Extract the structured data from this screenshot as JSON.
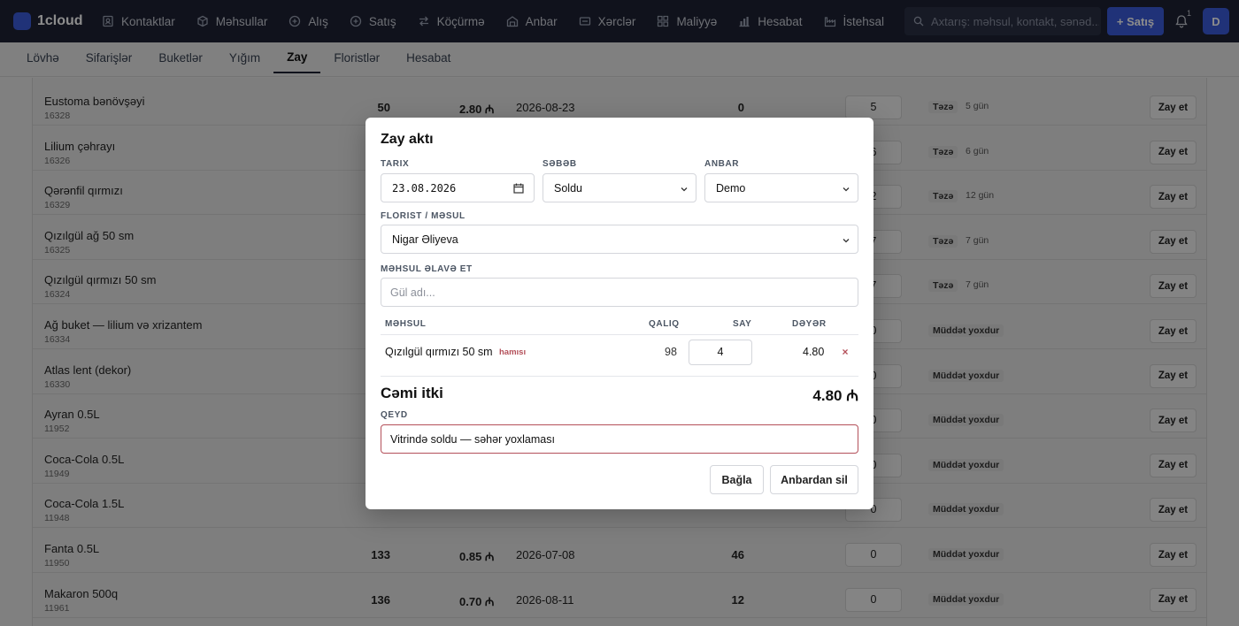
{
  "brand": {
    "name": "1cloud"
  },
  "nav": [
    {
      "label": "Kontaktlar",
      "icon": "contacts-icon"
    },
    {
      "label": "Məhsullar",
      "icon": "box-icon"
    },
    {
      "label": "Alış",
      "icon": "plus-circle-icon"
    },
    {
      "label": "Satış",
      "icon": "plus-circle-icon"
    },
    {
      "label": "Köçürmə",
      "icon": "transfer-icon"
    },
    {
      "label": "Anbar",
      "icon": "warehouse-icon"
    },
    {
      "label": "Xərclər",
      "icon": "wallet-icon"
    },
    {
      "label": "Maliyyə",
      "icon": "grid-icon"
    },
    {
      "label": "Hesabat",
      "icon": "bar-chart-icon"
    },
    {
      "label": "İstehsal",
      "icon": "factory-icon"
    }
  ],
  "search": {
    "placeholder": "Axtarış: məhsul, kontakt, sənəd..."
  },
  "header": {
    "sale_button": "+ Satış",
    "notif_count": "1",
    "avatar": "D"
  },
  "subtabs": [
    {
      "label": "Lövhə",
      "active": false
    },
    {
      "label": "Sifarişlər",
      "active": false
    },
    {
      "label": "Buketlər",
      "active": false
    },
    {
      "label": "Yığım",
      "active": false
    },
    {
      "label": "Zay",
      "active": true
    },
    {
      "label": "Floristlər",
      "active": false
    },
    {
      "label": "Hesabat",
      "active": false
    }
  ],
  "currency": "₼",
  "rows": [
    {
      "name": "Eustoma bənövşəyi",
      "id": "16328",
      "stock": "50",
      "price": "2.80 ₼",
      "date": "2026-08-23",
      "sold": "0",
      "qty": "5",
      "badge": "Təzə",
      "days": "5 gün",
      "action": "Zay et"
    },
    {
      "name": "Lilium çəhrayı",
      "id": "16326",
      "stock": "",
      "price": "",
      "date": "",
      "sold": "",
      "qty": "6",
      "badge": "Təzə",
      "days": "6 gün",
      "action": "Zay et"
    },
    {
      "name": "Qərənfil qırmızı",
      "id": "16329",
      "stock": "",
      "price": "",
      "date": "",
      "sold": "",
      "qty": "2",
      "badge": "Təzə",
      "days": "12 gün",
      "action": "Zay et"
    },
    {
      "name": "Qızılgül ağ 50 sm",
      "id": "16325",
      "stock": "",
      "price": "",
      "date": "",
      "sold": "",
      "qty": "7",
      "badge": "Təzə",
      "days": "7 gün",
      "action": "Zay et"
    },
    {
      "name": "Qızılgül qırmızı 50 sm",
      "id": "16324",
      "stock": "",
      "price": "",
      "date": "",
      "sold": "",
      "qty": "7",
      "badge": "Təzə",
      "days": "7 gün",
      "action": "Zay et"
    },
    {
      "name": "Ağ buket — lilium və xrizantem",
      "id": "16334",
      "stock": "",
      "price": "",
      "date": "",
      "sold": "",
      "qty": "0",
      "badge": "Müddət yoxdur",
      "days": "",
      "action": "Zay et"
    },
    {
      "name": "Atlas lent (dekor)",
      "id": "16330",
      "stock": "",
      "price": "",
      "date": "",
      "sold": "",
      "qty": "0",
      "badge": "Müddət yoxdur",
      "days": "",
      "action": "Zay et"
    },
    {
      "name": "Ayran 0.5L",
      "id": "11952",
      "stock": "",
      "price": "",
      "date": "",
      "sold": "",
      "qty": "0",
      "badge": "Müddət yoxdur",
      "days": "",
      "action": "Zay et"
    },
    {
      "name": "Coca-Cola 0.5L",
      "id": "11949",
      "stock": "",
      "price": "",
      "date": "",
      "sold": "",
      "qty": "0",
      "badge": "Müddət yoxdur",
      "days": "",
      "action": "Zay et"
    },
    {
      "name": "Coca-Cola 1.5L",
      "id": "11948",
      "stock": "",
      "price": "",
      "date": "",
      "sold": "",
      "qty": "0",
      "badge": "Müddət yoxdur",
      "days": "",
      "action": "Zay et"
    },
    {
      "name": "Fanta 0.5L",
      "id": "11950",
      "stock": "133",
      "price": "0.85 ₼",
      "date": "2026-07-08",
      "sold": "46",
      "qty": "0",
      "badge": "Müddət yoxdur",
      "days": "",
      "action": "Zay et"
    },
    {
      "name": "Makaron 500q",
      "id": "11961",
      "stock": "136",
      "price": "0.70 ₼",
      "date": "2026-08-11",
      "sold": "12",
      "qty": "0",
      "badge": "Müddət yoxdur",
      "days": "",
      "action": "Zay et"
    }
  ],
  "modal": {
    "title": "Zay aktı",
    "date_label": "Tarix",
    "date_value": "23.08.2026",
    "reason_label": "Səbəb",
    "reason_value": "Soldu",
    "warehouse_label": "Anbar",
    "warehouse_value": "Demo",
    "florist_label": "Florist / məsul",
    "florist_value": "Nigar Əliyeva",
    "add_label": "Məhsul əlavə et",
    "add_placeholder": "Gül adı...",
    "col_product": "Məhsul",
    "col_remaining": "Qalıq",
    "col_count": "Say",
    "col_value": "Dəyər",
    "item": {
      "name": "Qızılgül qırmızı 50 sm",
      "tag": "hamısı",
      "remaining": "98",
      "count": "4",
      "value": "4.80"
    },
    "total_label": "Cəmi itki",
    "total_value": "4.80 ₼",
    "note_label": "Qeyd",
    "note_value": "Vitrində soldu — səhər yoxlaması",
    "close_button": "Bağla",
    "writeoff_button": "Anbardan sil"
  },
  "colors": {
    "nav_bg": "#1e2233",
    "accent": "#3b5bdb",
    "danger": "#b4505a"
  }
}
